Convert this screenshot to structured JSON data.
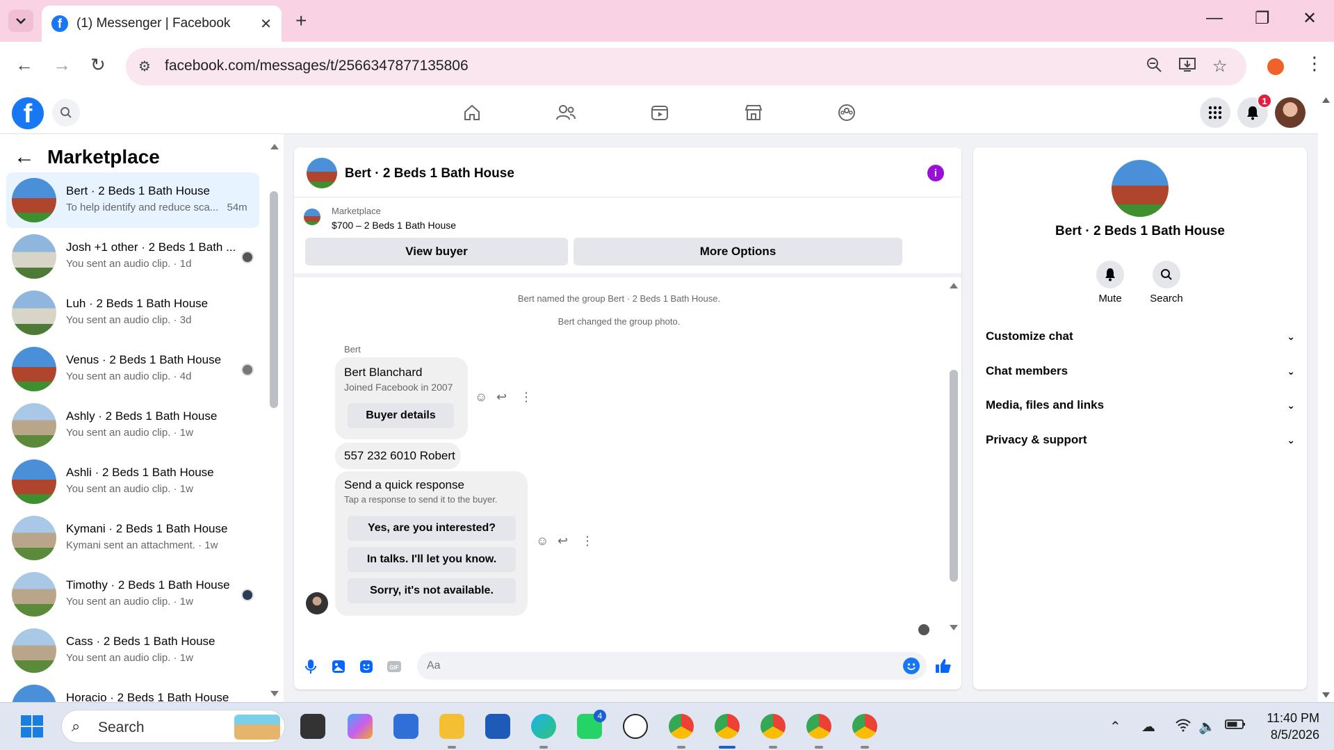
{
  "browser": {
    "tab_title": "(1) Messenger | Facebook",
    "url": "facebook.com/messages/t/2566347877135806"
  },
  "fb": {
    "notification_count": "1"
  },
  "left": {
    "title": "Marketplace",
    "conversations": [
      {
        "name": "Bert · 2 Beds 1 Bath House",
        "sub": "To help identify and reduce sca...",
        "time": "54m",
        "active": true
      },
      {
        "name": "Josh +1 other · 2 Beds 1 Bath ...",
        "sub": "You sent an audio clip. · 1d"
      },
      {
        "name": "Luh · 2 Beds 1 Bath House",
        "sub": "You sent an audio clip. · 3d"
      },
      {
        "name": "Venus · 2 Beds 1 Bath House",
        "sub": "You sent an audio clip. · 4d"
      },
      {
        "name": "Ashly · 2 Beds 1 Bath House",
        "sub": "You sent an audio clip. · 1w"
      },
      {
        "name": "Ashli · 2 Beds 1 Bath House",
        "sub": "You sent an audio clip. · 1w"
      },
      {
        "name": "Kymani · 2 Beds 1 Bath House",
        "sub": "Kymani sent an attachment. · 1w"
      },
      {
        "name": "Timothy · 2 Beds 1 Bath House",
        "sub": "You sent an audio clip. · 1w"
      },
      {
        "name": "Cass · 2 Beds 1 Bath House",
        "sub": "You sent an audio clip. · 1w"
      },
      {
        "name": "Horacio · 2 Beds 1 Bath House",
        "sub": ""
      }
    ]
  },
  "chat": {
    "title": "Bert · 2 Beds 1 Bath House",
    "marketplace_label": "Marketplace",
    "listing": "$700 – 2 Beds 1 Bath House",
    "view_buyer": "View buyer",
    "more_options": "More Options",
    "system_messages": [
      "Bert named the group Bert · 2 Beds 1 Bath House.",
      "Bert changed the group photo."
    ],
    "sender": "Bert",
    "card": {
      "name": "Bert Blanchard",
      "joined": "Joined Facebook in 2007",
      "button": "Buyer details"
    },
    "message": "557 232 6010 Robert",
    "quick": {
      "title": "Send a quick response",
      "sub": "Tap a response to send it to the buyer.",
      "options": [
        "Yes, are you interested?",
        "In talks. I'll let you know.",
        "Sorry, it's not available."
      ]
    },
    "composer_placeholder": "Aa"
  },
  "right": {
    "name": "Bert · 2 Beds 1 Bath House",
    "mute": "Mute",
    "search": "Search",
    "sections": [
      "Customize chat",
      "Chat members",
      "Media, files and links",
      "Privacy & support"
    ]
  },
  "taskbar": {
    "search": "Search",
    "whatsapp_badge": "4",
    "time": "11:40 PM",
    "date": "8/5/2026"
  }
}
